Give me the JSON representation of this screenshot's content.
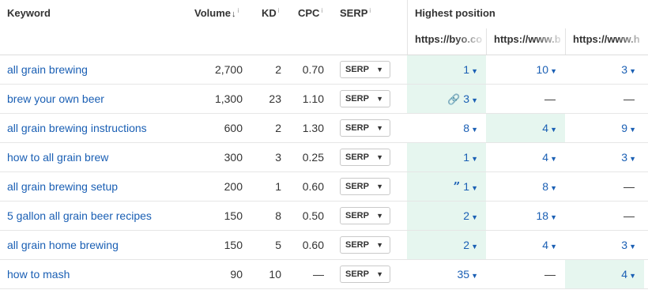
{
  "headers": {
    "keyword": "Keyword",
    "volume": "Volume",
    "volume_sort": "↓",
    "kd": "KD",
    "cpc": "CPC",
    "serp": "SERP",
    "info": "i",
    "highest_position": "Highest position",
    "urls": [
      "https://byo.co",
      "https://www.b",
      "https://www.h"
    ]
  },
  "icons": {
    "sort": "arrow-down-icon",
    "dropdown": "caret-down-icon",
    "link": "link-icon",
    "quote": "quote-icon"
  },
  "colors": {
    "link": "#1a5fb4",
    "highlight": "#e6f6ef"
  },
  "serp_label": "SERP",
  "rows": [
    {
      "keyword": "all grain brewing",
      "volume": "2,700",
      "kd": "2",
      "cpc": "0.70",
      "positions": [
        "1",
        "10",
        "3"
      ],
      "highlight": 0,
      "icon": ""
    },
    {
      "keyword": "brew your own beer",
      "volume": "1,300",
      "kd": "23",
      "cpc": "1.10",
      "positions": [
        "3",
        "—",
        "—"
      ],
      "highlight": 0,
      "icon": "link"
    },
    {
      "keyword": "all grain brewing instructions",
      "volume": "600",
      "kd": "2",
      "cpc": "1.30",
      "positions": [
        "8",
        "4",
        "9"
      ],
      "highlight": 1,
      "icon": ""
    },
    {
      "keyword": "how to all grain brew",
      "volume": "300",
      "kd": "3",
      "cpc": "0.25",
      "positions": [
        "1",
        "4",
        "3"
      ],
      "highlight": 0,
      "icon": ""
    },
    {
      "keyword": "all grain brewing setup",
      "volume": "200",
      "kd": "1",
      "cpc": "0.60",
      "positions": [
        "1",
        "8",
        "—"
      ],
      "highlight": 0,
      "icon": "quote"
    },
    {
      "keyword": "5 gallon all grain beer recipes",
      "volume": "150",
      "kd": "8",
      "cpc": "0.50",
      "positions": [
        "2",
        "18",
        "—"
      ],
      "highlight": 0,
      "icon": ""
    },
    {
      "keyword": "all grain home brewing",
      "volume": "150",
      "kd": "5",
      "cpc": "0.60",
      "positions": [
        "2",
        "4",
        "3"
      ],
      "highlight": 0,
      "icon": ""
    },
    {
      "keyword": "how to mash",
      "volume": "90",
      "kd": "10",
      "cpc": "—",
      "positions": [
        "35",
        "—",
        "4"
      ],
      "highlight": 2,
      "icon": ""
    }
  ]
}
